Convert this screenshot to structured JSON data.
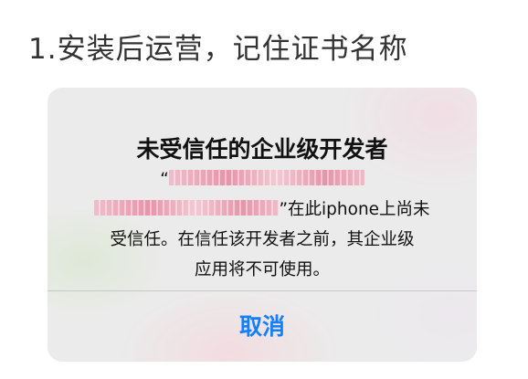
{
  "page": {
    "step_heading": "1.安装后运营，记住证书名称"
  },
  "alert": {
    "title": "未受信任的企业级开发者",
    "message": {
      "open_quote": "“",
      "line2_suffix": "”在此iphone上尚未",
      "line3": "受信任。在信任该开发者之前，其企业级",
      "line4": "应用将不可使用。"
    },
    "cancel_label": "取消"
  },
  "colors": {
    "accent": "#157efb",
    "redacted_blur": "#e88aa4"
  }
}
